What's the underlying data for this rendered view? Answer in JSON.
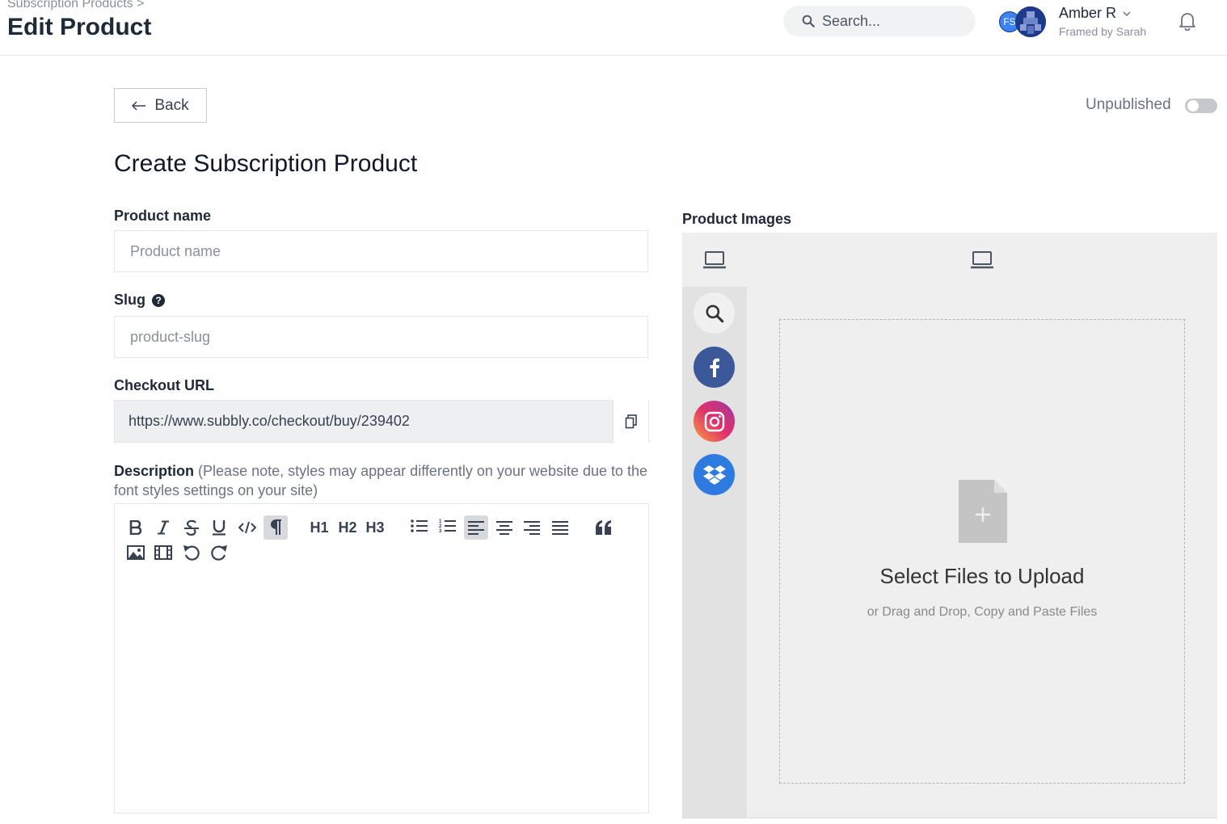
{
  "header": {
    "breadcrumb": "Subscription Products >",
    "title": "Edit Product",
    "search_placeholder": "Search...",
    "user": {
      "initials": "FS",
      "name": "Amber R",
      "store": "Framed by Sarah"
    }
  },
  "toolbar": {
    "back_label": "Back",
    "publish_status": "Unpublished",
    "published": false
  },
  "form": {
    "heading": "Create Subscription Product",
    "product_name": {
      "label": "Product name",
      "placeholder": "Product name",
      "value": ""
    },
    "slug": {
      "label": "Slug",
      "placeholder": "product-slug",
      "value": ""
    },
    "checkout_url": {
      "label": "Checkout URL",
      "value": "https://www.subbly.co/checkout/buy/239402"
    },
    "description": {
      "label": "Description",
      "note": "(Please note, styles may appear differently on your website due to the font styles settings on your site)",
      "toolbar": {
        "h1": "H1",
        "h2": "H2",
        "h3": "H3"
      }
    }
  },
  "images": {
    "label": "Product Images",
    "sources": [
      "search-icon",
      "facebook-icon",
      "instagram-icon",
      "dropbox-icon"
    ],
    "dropzone_title": "Select Files to Upload",
    "dropzone_subtitle": "or Drag and Drop, Copy and Paste Files"
  },
  "colors": {
    "facebook": "#3b5998",
    "dropbox": "#2d7be0",
    "toggle_off": "#c4c7cc"
  }
}
